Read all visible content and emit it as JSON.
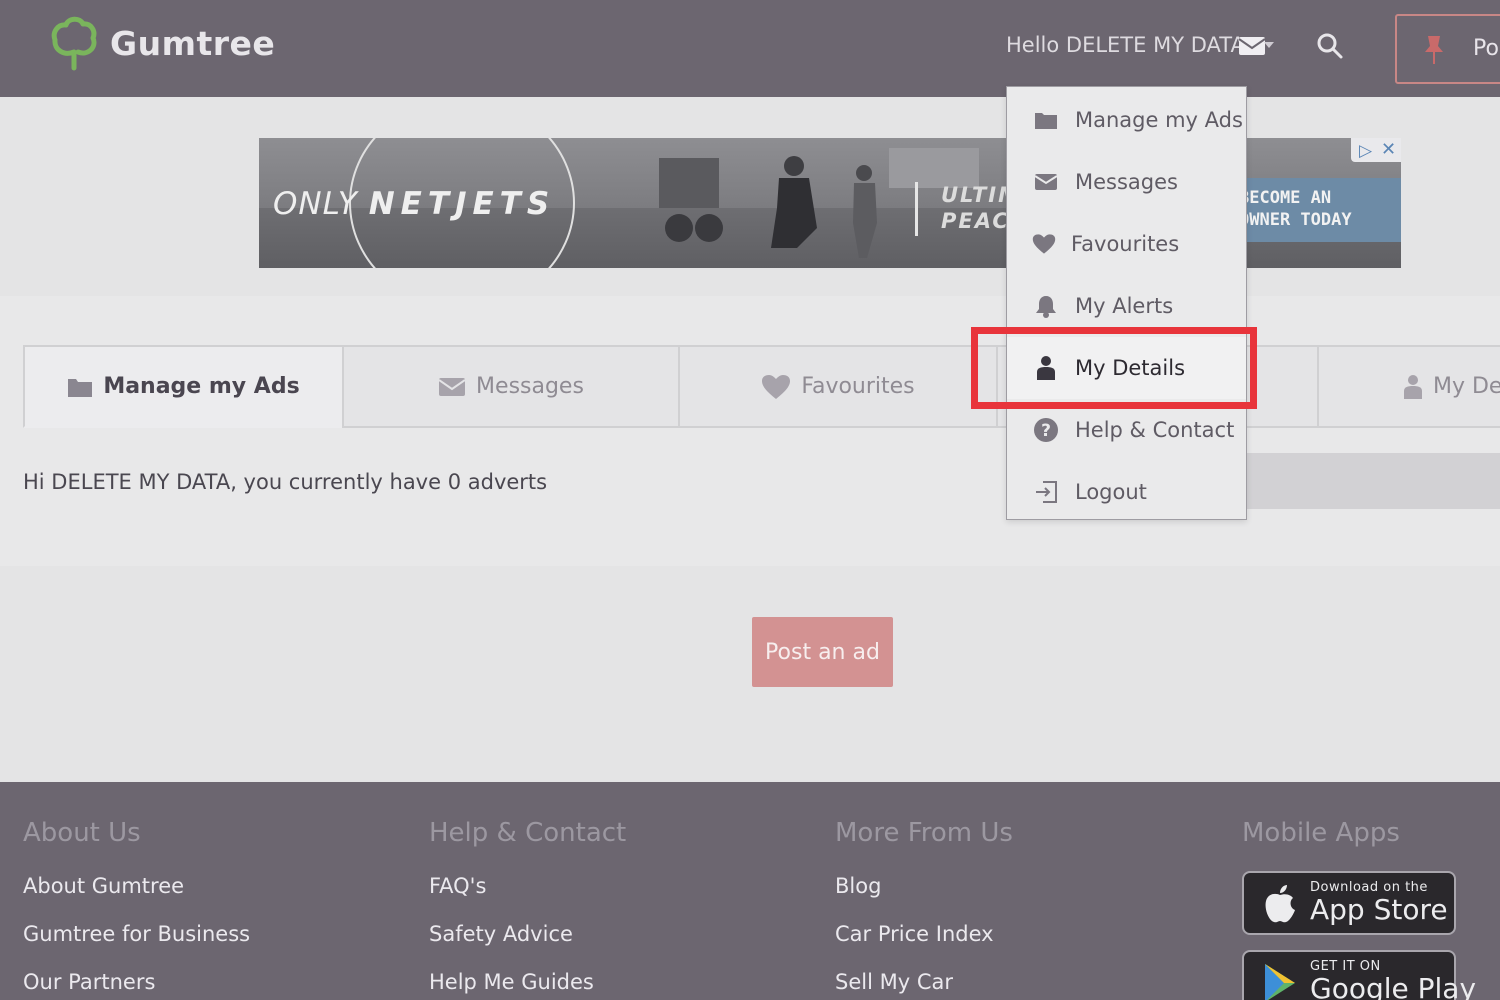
{
  "header": {
    "logo_text": "Gumtree",
    "hello": "Hello DELETE MY DATA",
    "post_short": "Po"
  },
  "ad": {
    "only": "ONLY",
    "brand": "NETJETS",
    "tagline_1": "ULTIM",
    "tagline_2": "PEAC",
    "cta_1": "BECOME AN",
    "cta_2": "OWNER TODAY"
  },
  "tabs": [
    {
      "label": "Manage my Ads",
      "icon": "folder-icon"
    },
    {
      "label": "Messages",
      "icon": "envelope-icon"
    },
    {
      "label": "Favourites",
      "icon": "heart-icon"
    },
    {
      "label": "My De",
      "icon": "person-icon"
    }
  ],
  "main": {
    "greeting": "Hi DELETE MY DATA, you currently have 0 adverts",
    "post_button": "Post an ad"
  },
  "dropdown": {
    "items": [
      {
        "label": "Manage my Ads",
        "icon": "folder-icon"
      },
      {
        "label": "Messages",
        "icon": "envelope-icon"
      },
      {
        "label": "Favourites",
        "icon": "heart-icon"
      },
      {
        "label": "My Alerts",
        "icon": "bell-icon"
      },
      {
        "label": "My Details",
        "icon": "person-icon"
      },
      {
        "label": "Help & Contact",
        "icon": "question-icon"
      },
      {
        "label": "Logout",
        "icon": "logout-icon"
      }
    ],
    "highlighted": "My Details"
  },
  "footer": {
    "columns": [
      {
        "title": "About Us",
        "links": [
          "About Gumtree",
          "Gumtree for Business",
          "Our Partners"
        ]
      },
      {
        "title": "Help & Contact",
        "links": [
          "FAQ's",
          "Safety Advice",
          "Help Me Guides"
        ]
      },
      {
        "title": "More From Us",
        "links": [
          "Blog",
          "Car Price Index",
          "Sell My Car"
        ]
      },
      {
        "title": "Mobile Apps",
        "links": []
      }
    ],
    "app_store": {
      "small": "Download on the",
      "big": "App Store"
    },
    "google_play": {
      "small": "GET IT ON",
      "big": "Google Play"
    }
  },
  "colors": {
    "header_bg": "#6c6670",
    "accent_green": "#7ab55c",
    "highlight_red": "#e8343b",
    "post_button": "#d39292"
  }
}
